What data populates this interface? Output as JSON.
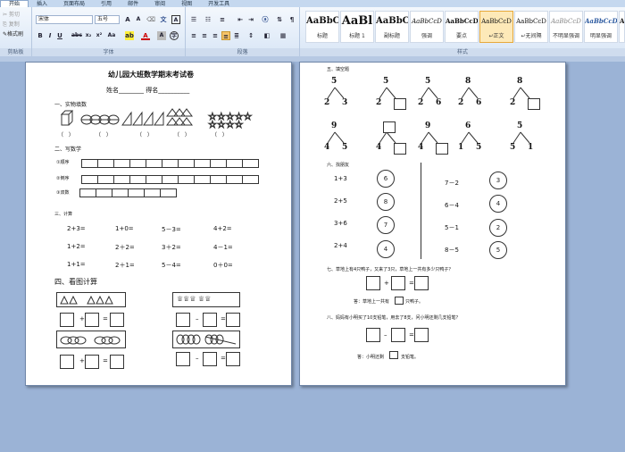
{
  "tabs": [
    "开始",
    "插入",
    "页面布局",
    "引用",
    "邮件",
    "审阅",
    "视图",
    "开发工具"
  ],
  "clipboard": {
    "cut": "剪切",
    "copy": "复制",
    "painter": "格式刷",
    "label": "剪贴板"
  },
  "font": {
    "name": "宋体",
    "size": "五号",
    "label": "字体"
  },
  "paragraph": {
    "label": "段落"
  },
  "styles": {
    "label": "样式",
    "items": [
      {
        "preview": "AaBbC",
        "name": "标题"
      },
      {
        "preview": "AaBl",
        "name": "标题 1"
      },
      {
        "preview": "AaBbC",
        "name": "副标题"
      },
      {
        "preview": "AaBbCcD",
        "name": "强调"
      },
      {
        "preview": "AaBbCcD",
        "name": "要点"
      },
      {
        "preview": "AaBbCcD",
        "name": "↵正文"
      },
      {
        "preview": "AaBbCcD",
        "name": "↵无间隔"
      },
      {
        "preview": "AaBbCcD",
        "name": "不明显强调"
      },
      {
        "preview": "AaBbCcD",
        "name": "明显强调"
      },
      {
        "preview": "AaBb",
        "name": "引用"
      }
    ]
  },
  "page1": {
    "title": "幼儿园大班数学期末考试卷",
    "name_line": "姓名________    得名__________",
    "s1": "一、实物填数",
    "s2": "二、写数学",
    "w1": "①顺序",
    "w2": "②倒序",
    "w3": "③双数",
    "s3": "三、计算",
    "calc": [
      "2+3=",
      "1+0=",
      "5－3=",
      "4+2=",
      "1+2=",
      "2＋2=",
      "3＋2=",
      "4－1=",
      "1+1=",
      "2＋1=",
      "5－4=",
      "0＋0="
    ],
    "s4": "四、看图计算",
    "paren": "（       ）"
  },
  "page2": {
    "s1": "五、填空题",
    "top": [
      "5",
      "5",
      "5",
      "8",
      "8"
    ],
    "left1": [
      "2",
      "2",
      "2",
      "2",
      "2"
    ],
    "right1": [
      "3",
      "",
      "6",
      "6",
      ""
    ],
    "top2": [
      "9",
      "",
      "9",
      "6",
      "5"
    ],
    "left2": [
      "4",
      "4",
      "4",
      "1",
      "5"
    ],
    "right2": [
      "5",
      "",
      "",
      "5",
      "1"
    ],
    "s6": "六、找朋友",
    "pairs_left": [
      "1+3",
      "2+5",
      "3+6",
      "2+4"
    ],
    "circles_left": [
      "6",
      "8",
      "7",
      "4"
    ],
    "pairs_right": [
      "7－2",
      "6－4",
      "5－1",
      "8－5"
    ],
    "circles_right": [
      "3",
      "4",
      "2",
      "5"
    ],
    "s7": "七、草地上有4只鸭子，又来了3只，草地上一共有多少只鸭子？",
    "a7": "答：草地上一共有",
    "a7b": "只鸭子。",
    "s8": "八、妈妈有小明买了10支铅笔，用去了8支，问小明还剩几支铅笔？",
    "a8": "答：小明还剩",
    "a8b": "支铅笔。"
  }
}
